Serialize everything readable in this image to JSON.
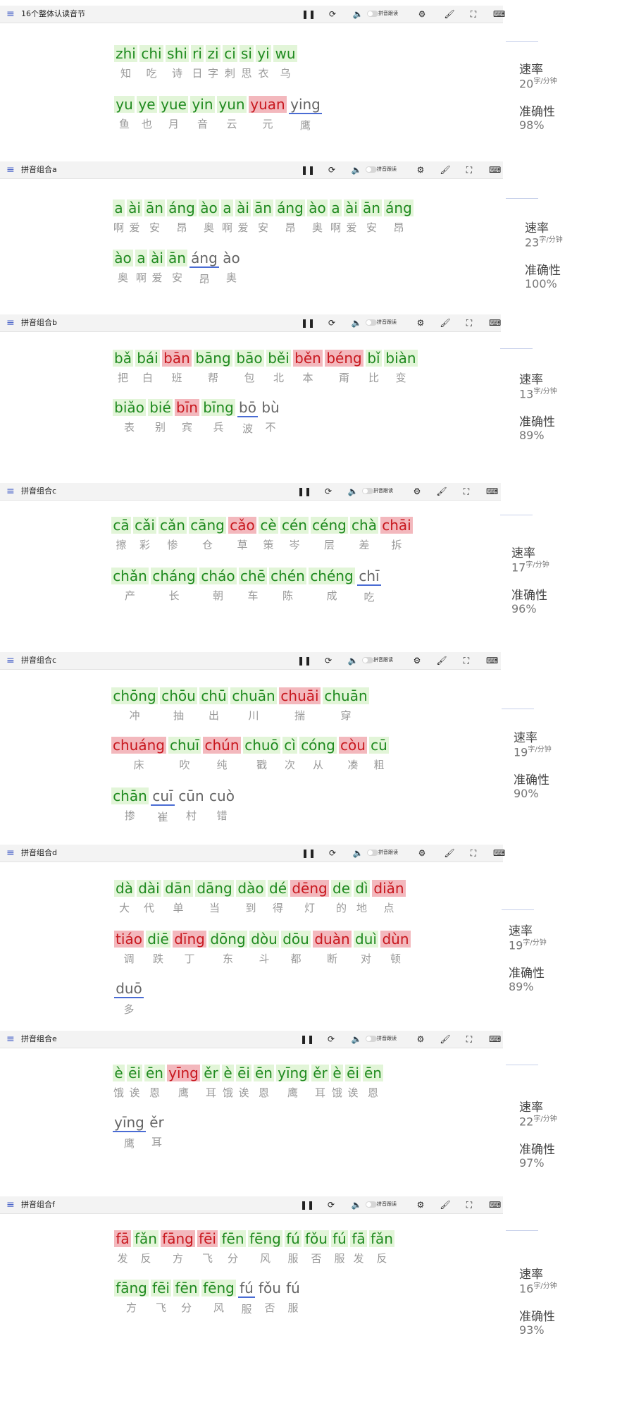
{
  "toolbar_controls": {
    "pause": "❚❚",
    "reset": "⟳",
    "sound": "🔈",
    "read_label": "拼音跟读",
    "settings": "⚙",
    "theme": "🖌",
    "fullscreen": "⛶",
    "keyboard": "⌨",
    "menu": "≡"
  },
  "speed_label": "速率",
  "accuracy_label": "准确性",
  "speed_unit": "字/分钟",
  "panels": [
    {
      "title": "16个整体认读音节",
      "speed": "20",
      "accuracy": "98%",
      "rows": [
        [
          [
            "zhi",
            "知"
          ],
          [
            "chi",
            "吃"
          ],
          [
            "shi",
            "诗"
          ],
          [
            "ri",
            "日"
          ],
          [
            "zi",
            "字"
          ],
          [
            "ci",
            "刺"
          ],
          [
            "si",
            "思"
          ],
          [
            "yi",
            "衣"
          ],
          [
            "wu",
            "乌"
          ]
        ],
        [
          [
            "yu",
            "鱼"
          ],
          [
            "ye",
            "也"
          ],
          [
            "yue",
            "月"
          ],
          [
            "yin",
            "音"
          ],
          [
            "yun",
            "云"
          ],
          [
            "yuan",
            "元"
          ],
          [
            "ying",
            "鹰"
          ]
        ]
      ]
    },
    {
      "title": "拼音组合a",
      "speed": "23",
      "accuracy": "100%",
      "rows": [
        [
          [
            "a",
            "啊"
          ],
          [
            "ài",
            "爱"
          ],
          [
            "ān",
            "安"
          ],
          [
            "áng",
            "昂"
          ],
          [
            "ào",
            "奥"
          ],
          [
            "a",
            "啊"
          ],
          [
            "ài",
            "爱"
          ],
          [
            "ān",
            "安"
          ],
          [
            "áng",
            "昂"
          ],
          [
            "ào",
            "奥"
          ],
          [
            "a",
            "啊"
          ],
          [
            "ài",
            "爱"
          ],
          [
            "ān",
            "安"
          ],
          [
            "áng",
            "昂"
          ]
        ],
        [
          [
            "ào",
            "奥"
          ],
          [
            "a",
            "啊"
          ],
          [
            "ài",
            "爱"
          ],
          [
            "ān",
            "安"
          ],
          [
            "áng",
            "昂"
          ],
          [
            "ào",
            "奥"
          ]
        ]
      ]
    },
    {
      "title": "拼音组合b",
      "speed": "13",
      "accuracy": "89%",
      "rows": [
        [
          [
            "bǎ",
            "把"
          ],
          [
            "bái",
            "白"
          ],
          [
            "bān",
            "班"
          ],
          [
            "bāng",
            "帮"
          ],
          [
            "bāo",
            "包"
          ],
          [
            "běi",
            "北"
          ],
          [
            "běn",
            "本"
          ],
          [
            "béng",
            "甭"
          ],
          [
            "bǐ",
            "比"
          ],
          [
            "biàn",
            "变"
          ]
        ],
        [
          [
            "biǎo",
            "表"
          ],
          [
            "bié",
            "别"
          ],
          [
            "bīn",
            "宾"
          ],
          [
            "bīng",
            "兵"
          ],
          [
            "bō",
            "波"
          ],
          [
            "bù",
            "不"
          ]
        ]
      ]
    },
    {
      "title": "拼音组合c",
      "speed": "17",
      "accuracy": "96%",
      "rows": [
        [
          [
            "cā",
            "擦"
          ],
          [
            "cǎi",
            "彩"
          ],
          [
            "cǎn",
            "惨"
          ],
          [
            "cāng",
            "仓"
          ],
          [
            "cǎo",
            "草"
          ],
          [
            "cè",
            "策"
          ],
          [
            "cén",
            "岑"
          ],
          [
            "céng",
            "层"
          ],
          [
            "chà",
            "差"
          ],
          [
            "chāi",
            "拆"
          ]
        ],
        [
          [
            "chǎn",
            "产"
          ],
          [
            "cháng",
            "长"
          ],
          [
            "cháo",
            "朝"
          ],
          [
            "chē",
            "车"
          ],
          [
            "chén",
            "陈"
          ],
          [
            "chéng",
            "成"
          ],
          [
            "chī",
            "吃"
          ]
        ]
      ]
    },
    {
      "title": "拼音组合c",
      "speed": "19",
      "accuracy": "90%",
      "rows": [
        [
          [
            "chōng",
            "冲"
          ],
          [
            "chōu",
            "抽"
          ],
          [
            "chū",
            "出"
          ],
          [
            "chuān",
            "川"
          ],
          [
            "chuāi",
            "揣"
          ],
          [
            "chuān",
            "穿"
          ]
        ],
        [
          [
            "chuáng",
            "床"
          ],
          [
            "chuī",
            "吹"
          ],
          [
            "chún",
            "纯"
          ],
          [
            "chuō",
            "戳"
          ],
          [
            "cì",
            "次"
          ],
          [
            "cóng",
            "从"
          ],
          [
            "còu",
            "凑"
          ],
          [
            "cū",
            "粗"
          ]
        ],
        [
          [
            "chān",
            "掺"
          ],
          [
            "cuī",
            "崔"
          ],
          [
            "cūn",
            "村"
          ],
          [
            "cuò",
            "错"
          ]
        ]
      ]
    },
    {
      "title": "拼音组合d",
      "speed": "19",
      "accuracy": "89%",
      "rows": [
        [
          [
            "dà",
            "大"
          ],
          [
            "dài",
            "代"
          ],
          [
            "dān",
            "单"
          ],
          [
            "dāng",
            "当"
          ],
          [
            "dào",
            "到"
          ],
          [
            "dé",
            "得"
          ],
          [
            "dēng",
            "灯"
          ],
          [
            "de",
            "的"
          ],
          [
            "dì",
            "地"
          ],
          [
            "diǎn",
            "点"
          ]
        ],
        [
          [
            "tiáo",
            "调"
          ],
          [
            "diē",
            "跌"
          ],
          [
            "dīng",
            "丁"
          ],
          [
            "dōng",
            "东"
          ],
          [
            "dòu",
            "斗"
          ],
          [
            "dōu",
            "都"
          ],
          [
            "duàn",
            "断"
          ],
          [
            "duì",
            "对"
          ],
          [
            "dùn",
            "顿"
          ]
        ],
        [
          [
            "duō",
            "多"
          ]
        ]
      ]
    },
    {
      "title": "拼音组合e",
      "speed": "22",
      "accuracy": "97%",
      "rows": [
        [
          [
            "è",
            "饿"
          ],
          [
            "ēi",
            "诶"
          ],
          [
            "ēn",
            "恩"
          ],
          [
            "yīng",
            "鹰"
          ],
          [
            "ěr",
            "耳"
          ],
          [
            "è",
            "饿"
          ],
          [
            "ēi",
            "诶"
          ],
          [
            "ēn",
            "恩"
          ],
          [
            "yīng",
            "鹰"
          ],
          [
            "ěr",
            "耳"
          ],
          [
            "è",
            "饿"
          ],
          [
            "ēi",
            "诶"
          ],
          [
            "ēn",
            "恩"
          ]
        ],
        [
          [
            "yīng",
            "鹰"
          ],
          [
            "ěr",
            "耳"
          ]
        ]
      ]
    },
    {
      "title": "拼音组合f",
      "speed": "16",
      "accuracy": "93%",
      "rows": [
        [
          [
            "fā",
            "发"
          ],
          [
            "fǎn",
            "反"
          ],
          [
            "fāng",
            "方"
          ],
          [
            "fēi",
            "飞"
          ],
          [
            "fēn",
            "分"
          ],
          [
            "fēng",
            "风"
          ],
          [
            "fú",
            "服"
          ],
          [
            "fǒu",
            "否"
          ],
          [
            "fú",
            "服"
          ],
          [
            "fā",
            "发"
          ],
          [
            "fǎn",
            "反"
          ]
        ],
        [
          [
            "fāng",
            "方"
          ],
          [
            "fēi",
            "飞"
          ],
          [
            "fēn",
            "分"
          ],
          [
            "fēng",
            "风"
          ],
          [
            "fú",
            "服"
          ],
          [
            "fǒu",
            "否"
          ],
          [
            "fú",
            "服"
          ]
        ]
      ]
    }
  ]
}
